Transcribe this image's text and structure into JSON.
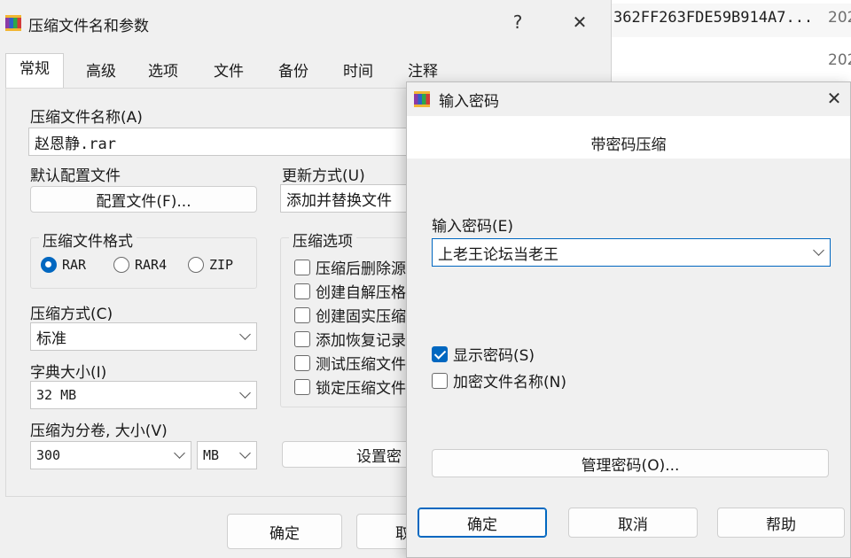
{
  "background": {
    "row1_hash": "362FF263FDE59B914A7...",
    "row1_date": "202",
    "row2_date": "202"
  },
  "archive_dialog": {
    "title": "压缩文件名和参数",
    "help_button": "?",
    "close_button": "✕",
    "tabs": [
      "常规",
      "高级",
      "选项",
      "文件",
      "备份",
      "时间",
      "注释"
    ],
    "archive_name_label": "压缩文件名称(A)",
    "archive_name_value": "赵恩静.rar",
    "default_profile_label": "默认配置文件",
    "profile_button": "配置文件(F)...",
    "update_mode_label": "更新方式(U)",
    "update_mode_value": "添加并替换文件",
    "format_group_label": "压缩文件格式",
    "format_options": [
      {
        "label": "RAR",
        "selected": true
      },
      {
        "label": "RAR4",
        "selected": false
      },
      {
        "label": "ZIP",
        "selected": false
      }
    ],
    "compression_options_label": "压缩选项",
    "compression_options": [
      {
        "label": "压缩后删除源",
        "checked": false
      },
      {
        "label": "创建自解压格",
        "checked": false
      },
      {
        "label": "创建固实压缩",
        "checked": false
      },
      {
        "label": "添加恢复记录",
        "checked": false
      },
      {
        "label": "测试压缩文件",
        "checked": false
      },
      {
        "label": "锁定压缩文件",
        "checked": false
      }
    ],
    "method_label": "压缩方式(C)",
    "method_value": "标准",
    "dictionary_label": "字典大小(I)",
    "dictionary_value": "32 MB",
    "split_label": "压缩为分卷, 大小(V)",
    "split_value": "300",
    "split_unit": "MB",
    "set_password_button": "设置密",
    "ok_button": "确定",
    "cancel_button": "取"
  },
  "password_dialog": {
    "title": "输入密码",
    "close_button": "✕",
    "header": "带密码压缩",
    "password_label": "输入密码(E)",
    "password_value": "上老王论坛当老王",
    "show_password_label": "显示密码(S)",
    "show_password_checked": true,
    "encrypt_names_label": "加密文件名称(N)",
    "encrypt_names_checked": false,
    "organize_button": "管理密码(O)...",
    "ok_button": "确定",
    "cancel_button": "取消",
    "help_button": "帮助"
  },
  "colors": {
    "accent": "#0067c0",
    "dialog_bg": "#f0f0f0"
  }
}
